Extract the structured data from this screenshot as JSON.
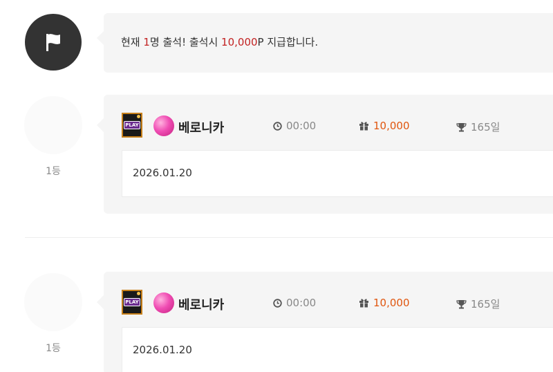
{
  "notice": {
    "prefix": "현재 ",
    "count": "1",
    "middle": "명 출석! 출석시 ",
    "points": "10,000",
    "suffix": "P 지급합니다."
  },
  "entries": [
    {
      "rank": "1등",
      "nickname": "베로니카",
      "time": "00:00",
      "points": "10,000",
      "days": "165일",
      "date": "2026.01.20",
      "level_icon_text": "PLAY"
    },
    {
      "rank": "1등",
      "nickname": "베로니카",
      "time": "00:00",
      "points": "10,000",
      "days": "165일",
      "date": "2026.01.20",
      "level_icon_text": "PLAY"
    }
  ],
  "icons": {
    "notice": "flag-icon",
    "time": "clock-icon",
    "points": "gift-icon",
    "days": "trophy-icon",
    "level": "level-icon",
    "member": "candy-icon"
  },
  "colors": {
    "highlight": "#c22222",
    "points": "#e0560f",
    "muted": "#888888",
    "flag_bg": "#333333",
    "card_bg": "#f5f5f5"
  }
}
